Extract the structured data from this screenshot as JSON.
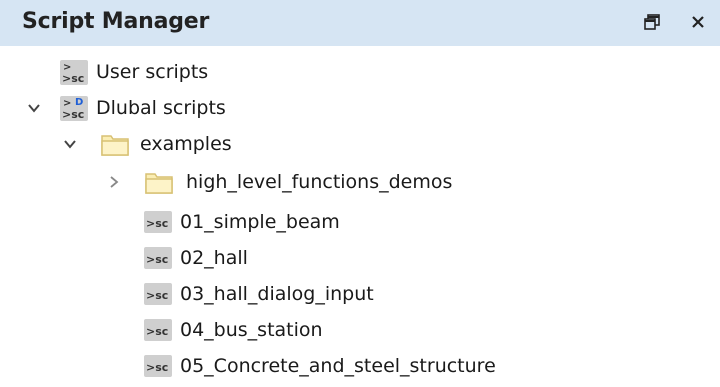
{
  "header": {
    "title": "Script Manager",
    "float_icon": "float-window-icon",
    "close_icon": "close-icon"
  },
  "tree": {
    "user_scripts": {
      "label": "User scripts",
      "icon": "script-group-icon"
    },
    "dlubal_scripts": {
      "label": "Dlubal scripts",
      "icon": "dlubal-script-group-icon",
      "expanded": true
    },
    "examples": {
      "label": "examples",
      "icon": "folder-icon",
      "expanded": true
    },
    "items": [
      {
        "label": "high_level_functions_demos",
        "type": "folder",
        "icon": "folder-icon",
        "expanded": false
      },
      {
        "label": "01_simple_beam",
        "type": "script",
        "icon": "script-file-icon"
      },
      {
        "label": "02_hall",
        "type": "script",
        "icon": "script-file-icon"
      },
      {
        "label": "03_hall_dialog_input",
        "type": "script",
        "icon": "script-file-icon"
      },
      {
        "label": "04_bus_station",
        "type": "script",
        "icon": "script-file-icon"
      },
      {
        "label": "05_Concrete_and_steel_structure",
        "type": "script",
        "icon": "script-file-icon"
      }
    ]
  },
  "colors": {
    "header_bg": "#d6e5f3",
    "folder_fill": "#fbeeb4",
    "folder_stroke": "#d8c174",
    "dlubal_blue": "#1f5fd6"
  }
}
